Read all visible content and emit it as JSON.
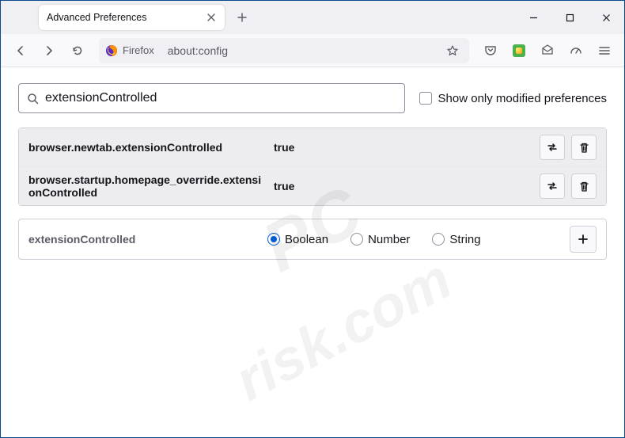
{
  "window": {
    "tab_title": "Advanced Preferences"
  },
  "navbar": {
    "identity_label": "Firefox",
    "url": "about:config"
  },
  "search": {
    "value": "extensionControlled",
    "checkbox_label": "Show only modified preferences"
  },
  "prefs": [
    {
      "name": "browser.newtab.extensionControlled",
      "value": "true"
    },
    {
      "name": "browser.startup.homepage_override.extensionControlled",
      "value": "true"
    }
  ],
  "newpref": {
    "name": "extensionControlled",
    "types": [
      "Boolean",
      "Number",
      "String"
    ],
    "selected": 0
  }
}
